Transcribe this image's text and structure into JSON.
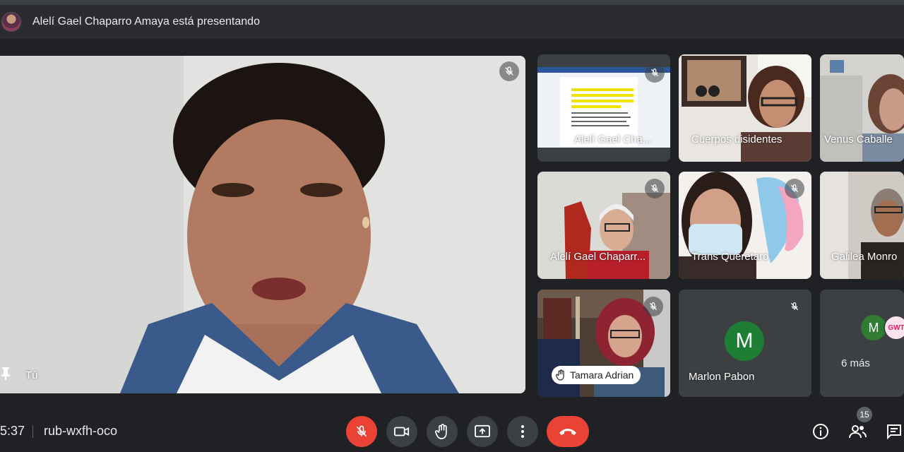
{
  "presenting": {
    "text": "Alelí Gael Chaparro Amaya está presentando",
    "avatar": "presenter-avatar"
  },
  "main_tile": {
    "name": "Tú",
    "mic": "mic-off-icon"
  },
  "tiles": [
    {
      "name": "Alelí Gael Cha...",
      "muted": true
    },
    {
      "name": "Cuerpos disidentes",
      "muted": false
    },
    {
      "name": "Venus Caballe",
      "muted": false
    },
    {
      "name": "Alelí Gael Chaparr...",
      "muted": true
    },
    {
      "name": "Trans Querétaro",
      "muted": true
    },
    {
      "name": "Galilea Monro",
      "muted": false
    },
    {
      "name": "Tamara Adrian",
      "muted": true,
      "hand_raised": true
    },
    {
      "name": "Marlon Pabon",
      "muted": true,
      "initial": "M"
    },
    {
      "name": "6 más",
      "initial": "M",
      "logo_text": "GWT"
    }
  ],
  "bottom_bar": {
    "time": "5:37",
    "meeting_code": "rub-wxfh-oco",
    "participants_count": "15"
  },
  "colors": {
    "background": "#202124",
    "tile_bg": "#3c4043",
    "danger": "#ea4335",
    "active_outline": "#8ab4f8",
    "avatar_green": "#1e7e34"
  }
}
